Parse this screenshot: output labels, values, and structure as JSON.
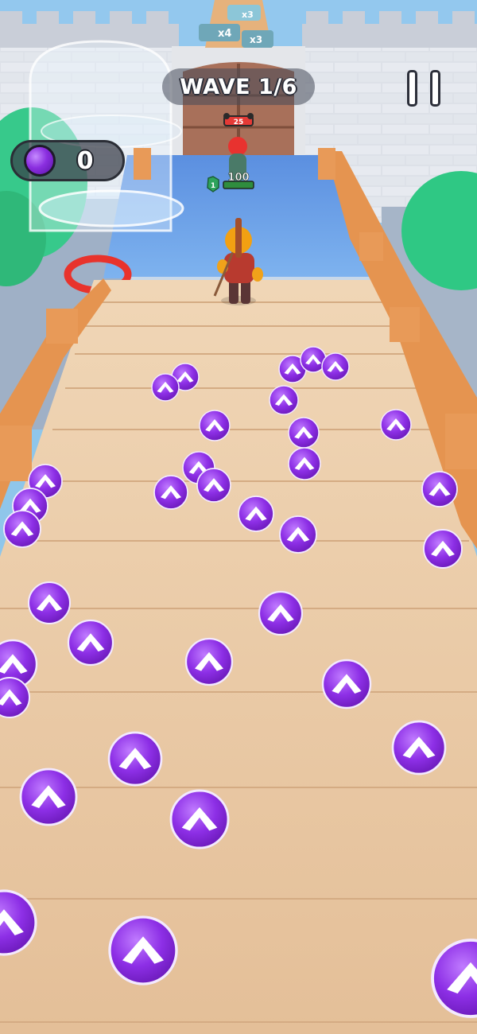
{
  "hud": {
    "wave_label": "WAVE 1/6",
    "gem_count": "0",
    "pause_icon": "pause-icon",
    "gem_icon": "purple-gem-icon"
  },
  "enemy": {
    "health": "25",
    "shield_level": "1",
    "hp": "100"
  },
  "ramp": {
    "multiplier_a": "x3",
    "multiplier_b": "x4",
    "multiplier_c": "x3"
  },
  "colors": {
    "gem_purple": "#8b2fe0",
    "deck_wood": "#e9c9a3",
    "railing": "#e89a58",
    "water": "#4f8fe0",
    "wall": "#dfe3ea"
  }
}
